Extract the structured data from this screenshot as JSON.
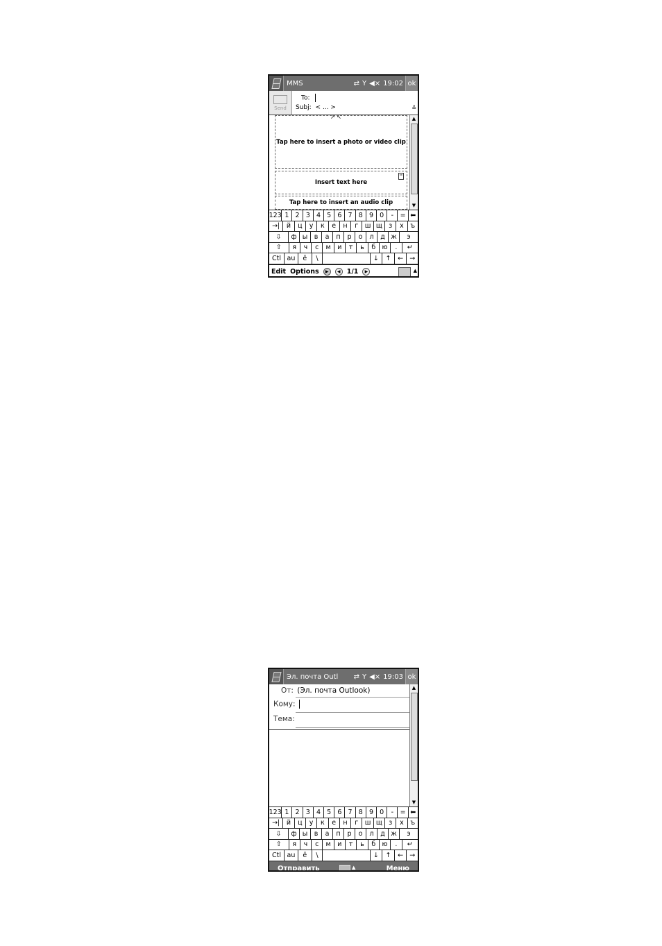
{
  "screen1": {
    "app_title": "MMS",
    "time": "19:02",
    "ok": "ok",
    "send_label": "Send",
    "to_label": "To:",
    "subj_label": "Subj:",
    "subj_value": "< ... >",
    "photo_slot": "Tap here to insert a photo or video clip",
    "text_slot": "Insert text here",
    "audio_slot": "Tap here to insert an audio clip",
    "menu_edit": "Edit",
    "menu_options": "Options",
    "page_indicator": "1/1"
  },
  "screen2": {
    "app_title": "Эл. почта Outl",
    "time": "19:03",
    "ok": "ok",
    "from_label": "От:",
    "from_value": "(Эл. почта Outlook)",
    "to_label": "Кому:",
    "subject_label": "Тема:",
    "send_label": "Отправить",
    "menu_label": "Меню"
  },
  "keyboard": {
    "rows": [
      [
        "123",
        "1",
        "2",
        "3",
        "4",
        "5",
        "6",
        "7",
        "8",
        "9",
        "0",
        "-",
        "=",
        "⬅"
      ],
      [
        "→|",
        "й",
        "ц",
        "у",
        "к",
        "е",
        "н",
        "г",
        "ш",
        "щ",
        "з",
        "х",
        "ъ"
      ],
      [
        "⇩",
        "ф",
        "ы",
        "в",
        "а",
        "п",
        "р",
        "о",
        "л",
        "д",
        "ж",
        "э"
      ],
      [
        "⇧",
        "я",
        "ч",
        "с",
        "м",
        "и",
        "т",
        "ь",
        "б",
        "ю",
        ".",
        "↵"
      ],
      [
        "Ctl",
        "аu",
        "ё",
        "\\",
        " ",
        "↓",
        "↑",
        "←",
        "→"
      ]
    ]
  },
  "icons": [
    "windows-logo-icon",
    "sync-icon",
    "signal-icon",
    "speaker-mute-icon",
    "keyboard-icon",
    "chevron-down-double-icon",
    "envelope-icon"
  ]
}
